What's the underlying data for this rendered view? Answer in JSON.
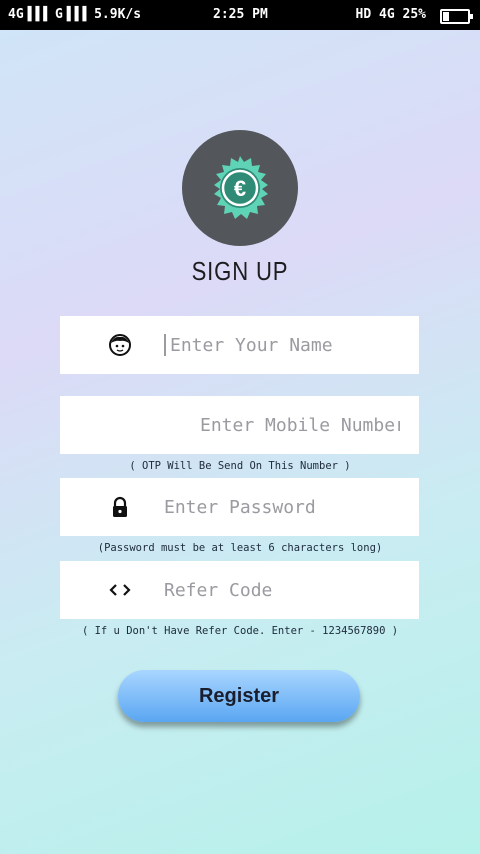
{
  "status_bar": {
    "left": "4G▐▐▐ G▐▐▐ 5.9K/s",
    "time": "2:25 PM",
    "right": "HD 4G 25%",
    "battery_percent": 25
  },
  "logo": {
    "symbol": "€",
    "icon": "euro-coin-icon"
  },
  "title": "SIGN UP",
  "form": {
    "name_placeholder": "Enter Your Name",
    "mobile_placeholder": "Enter Mobile Number",
    "mobile_hint": "( OTP Will Be Send On This Number )",
    "password_placeholder": "Enter Password",
    "password_hint": "(Password must be at least 6 characters long)",
    "refer_placeholder": "Refer Code",
    "refer_hint": "( If u Don't Have Refer Code. Enter - 1234567890 )",
    "register_label": "Register"
  },
  "colors": {
    "accent": "#5aa6f2",
    "logo_bg": "#53565b",
    "coin": "#5fd3b5"
  }
}
